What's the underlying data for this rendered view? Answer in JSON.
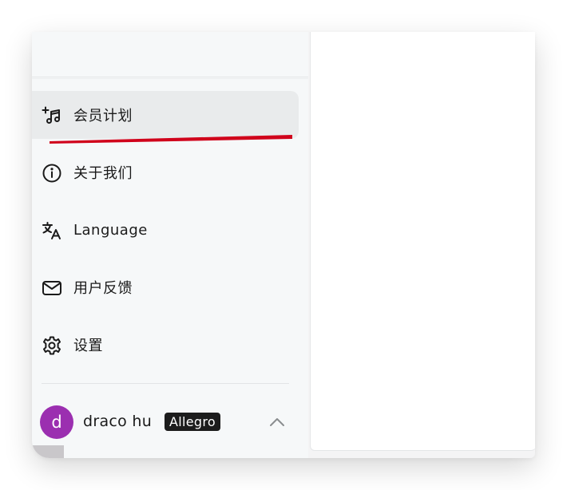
{
  "menu": {
    "items": [
      {
        "label": "会员计划",
        "icon": "music-note-plus-icon",
        "active": true
      },
      {
        "label": "关于我们",
        "icon": "info-circle-icon",
        "active": false
      },
      {
        "label": "Language",
        "icon": "translate-icon",
        "active": false
      },
      {
        "label": "用户反馈",
        "icon": "mail-icon",
        "active": false
      },
      {
        "label": "设置",
        "icon": "gear-icon",
        "active": false
      }
    ]
  },
  "user": {
    "avatar_letter": "d",
    "name": "draco hu",
    "plan_badge": "Allegro",
    "menu_toggle_icon": "chevron-up-icon"
  },
  "colors": {
    "avatar": "#9b2fb0",
    "badge_bg": "#1c1c1c",
    "underline_annotation": "#d0021b",
    "active_item_bg": "#e9ebec"
  }
}
